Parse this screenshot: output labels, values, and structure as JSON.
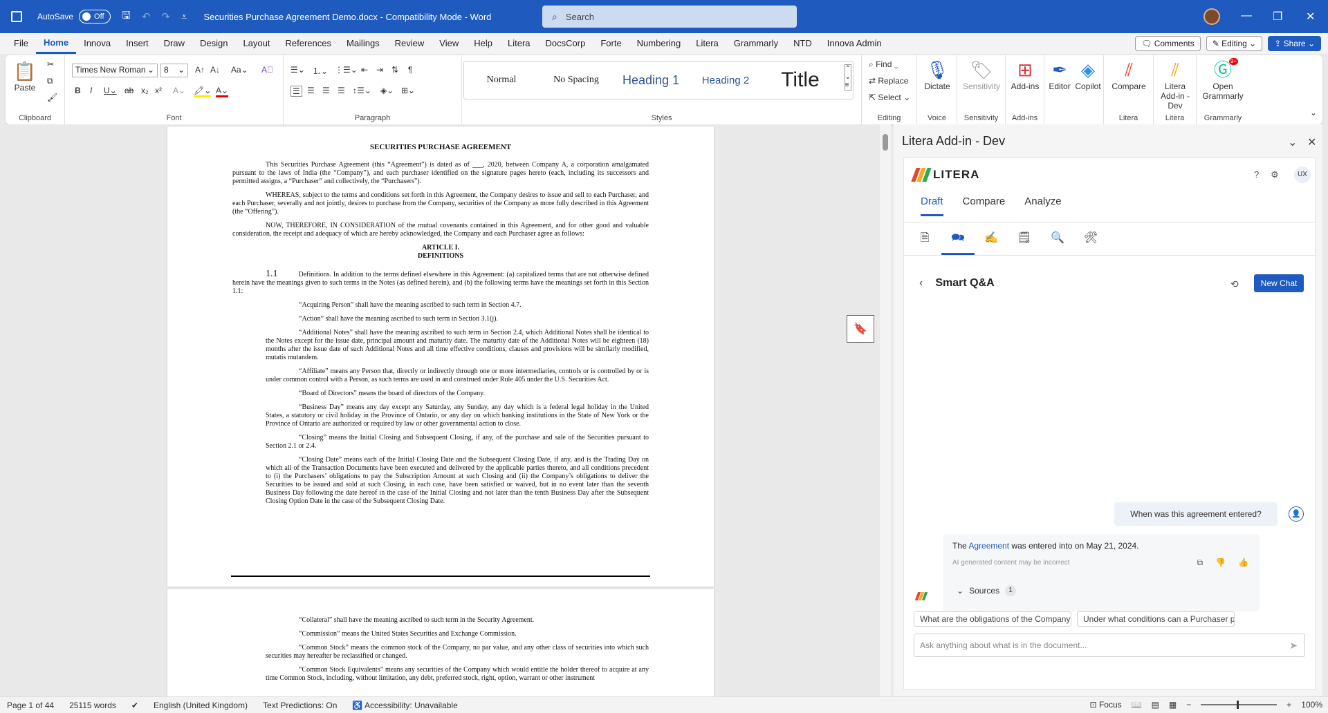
{
  "titlebar": {
    "autosave_label": "AutoSave",
    "autosave_state": "Off",
    "doc_title": "Securities Purchase Agreement Demo.docx  -  Compatibility Mode  -  Word",
    "search_placeholder": "Search"
  },
  "menu": {
    "tabs": [
      "File",
      "Home",
      "Innova",
      "Insert",
      "Draw",
      "Design",
      "Layout",
      "References",
      "Mailings",
      "Review",
      "View",
      "Help",
      "Litera",
      "DocsCorp",
      "Forte",
      "Numbering",
      "Litera",
      "Grammarly",
      "NTD",
      "Innova Admin"
    ],
    "active": "Home",
    "comments": "Comments",
    "editing": "Editing",
    "share": "Share"
  },
  "ribbon": {
    "clipboard": {
      "paste": "Paste",
      "label": "Clipboard"
    },
    "font": {
      "family": "Times New Roman",
      "size": "8",
      "label": "Font"
    },
    "paragraph": {
      "label": "Paragraph"
    },
    "styles": {
      "items": [
        "Normal",
        "No Spacing",
        "Heading 1",
        "Heading 2",
        "Title"
      ],
      "label": "Styles"
    },
    "editing": {
      "find": "Find",
      "replace": "Replace",
      "select": "Select",
      "label": "Editing"
    },
    "voice": {
      "dictate": "Dictate",
      "label": "Voice"
    },
    "sensitivity": {
      "btn": "Sensitivity",
      "label": "Sensitivity"
    },
    "addins": {
      "btn": "Add-ins",
      "label": "Add-ins"
    },
    "editor": "Editor",
    "copilot": "Copilot",
    "litera": {
      "compare": "Compare",
      "label": "Litera"
    },
    "litera2": {
      "btn": "Litera Add-in - Dev",
      "label": "Litera"
    },
    "grammarly": {
      "btn": "Open Grammarly",
      "label": "Grammarly",
      "badge": "9+"
    }
  },
  "document": {
    "title": "SECURITIES PURCHASE AGREEMENT",
    "intro": "This Securities Purchase Agreement (this “Agreement”) is dated as of ___, 2020, between Company A, a corporation amalgamated pursuant to the laws of India (the “Company”), and each purchaser identified on the signature pages hereto (each, including its successors and permitted assigns, a “Purchaser” and collectively, the “Purchasers”).",
    "whereas": "WHEREAS, subject to the terms and conditions set forth in this Agreement, the Company desires to issue and sell to each Purchaser, and each Purchaser, severally and not jointly, desires to purchase from the Company, securities of the Company as more fully described in this Agreement (the “Offering”).",
    "now": "NOW, THEREFORE, IN CONSIDERATION of the mutual covenants contained in this Agreement, and for other good and valuable consideration, the receipt and adequacy of which are hereby acknowledged, the Company and each Purchaser agree as follows:",
    "article": "ARTICLE I.",
    "article_title": "DEFINITIONS",
    "sec_num": "1.1",
    "sec_text": "Definitions. In addition to the terms defined elsewhere in this Agreement: (a) capitalized terms that are not otherwise defined herein have the meanings given to such terms in the Notes (as defined herein), and (b) the following terms have the meanings set forth in this Section 1.1:",
    "defs": [
      "“Acquiring Person” shall have the meaning ascribed to such term in Section 4.7.",
      "“Action” shall have the meaning ascribed to such term in Section 3.1(j).",
      "“Additional Notes” shall have the meaning ascribed to such term in Section 2.4, which Additional Notes shall be identical to the Notes except for the issue date, principal amount and maturity date. The maturity date of the Additional Notes will be eighteen (18) months after the issue date of such Additional Notes and all time effective conditions, clauses and provisions will be similarly modified, mutatis mutandem.",
      "“Affiliate” means any Person that, directly or indirectly through one or more intermediaries, controls or is controlled by or is under common control with a Person, as such terms are used in and construed under Rule 405 under the U.S. Securities Act.",
      "“Board of Directors” means the board of directors of the Company.",
      "“Business Day” means any day except any Saturday, any Sunday, any day which is a federal legal holiday in the United States, a statutory or civil holiday in the Province of Ontario, or any day on which banking institutions in the State of New York or the Province of Ontario are authorized or required by law or other governmental action to close.",
      "“Closing” means the Initial Closing and Subsequent Closing, if any, of the purchase and sale of the Securities pursuant to Section 2.1 or 2.4.",
      "“Closing Date” means each of the Initial Closing Date and the Subsequent Closing Date, if any, and is the Trading Day on which all of the Transaction Documents have been executed and delivered by the applicable parties thereto, and all conditions precedent to (i) the Purchasers’ obligations to pay the Subscription Amount at such Closing and (ii) the Company’s obligations to deliver the Securities to be issued and sold at such Closing, in each case, have been satisfied or waived, but in no event later than the seventh Business Day following the date hereof in the case of the Initial Closing and not later than the tenth Business Day after the Subsequent Closing Option Date in the case of the Subsequent Closing Date."
    ],
    "defs_p2": [
      "“Collateral” shall have the meaning ascribed to such term in the Security Agreement.",
      "“Commission” means the United States Securities and Exchange Commission.",
      "“Common Stock” means the common stock of the Company, no par value, and any other class of securities into which such securities may hereafter be reclassified or changed.",
      "“Common Stock Equivalents” means any securities of the Company which would entitle the holder thereof to acquire at any time Common Stock, including, without limitation, any debt, preferred stock, right, option, warrant or other instrument"
    ]
  },
  "pane": {
    "title": "Litera Add-in - Dev",
    "brand": "LITERA",
    "ux": "UX",
    "tabs": [
      "Draft",
      "Compare",
      "Analyze"
    ],
    "active_tab": "Draft",
    "section": "Smart Q&A",
    "new_chat": "New Chat",
    "question": "When was this agreement entered?",
    "answer_pre": "The ",
    "answer_link": "Agreement",
    "answer_post": " was entered into on May 21, 2024.",
    "disclaimer": "AI generated content may be incorrect",
    "sources": "Sources",
    "sources_count": "1",
    "suggestions": [
      "What are the obligations of the Company to...",
      "Under what conditions can a Purchaser parti..."
    ],
    "ask_placeholder": "Ask anything about what is in the document...",
    "brand_colors": [
      "#e8452c",
      "#f7a81b",
      "#2fa84f"
    ]
  },
  "status": {
    "page": "Page 1 of 44",
    "words": "25115 words",
    "language": "English (United Kingdom)",
    "predictions": "Text Predictions: On",
    "accessibility": "Accessibility: Unavailable",
    "focus": "Focus",
    "zoom": "100%"
  }
}
